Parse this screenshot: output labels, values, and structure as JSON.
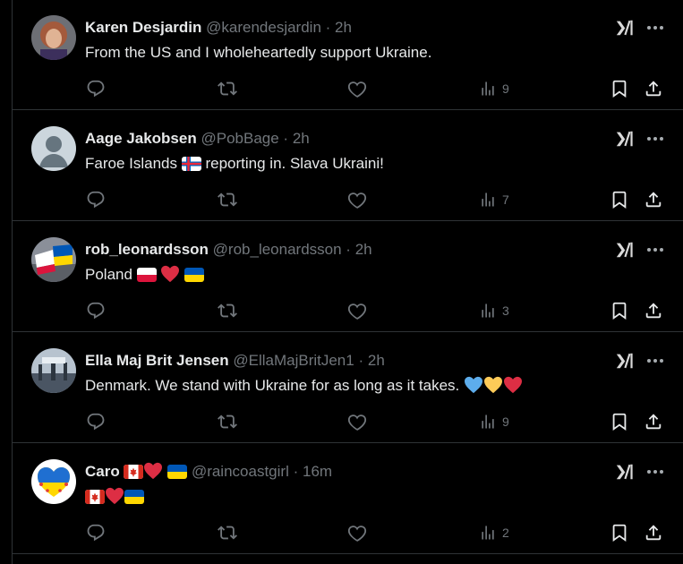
{
  "tweets": [
    {
      "name": "Karen Desjardin",
      "handle": "@karendesjardin",
      "dot": "·",
      "time": "2h",
      "text": "From the US and I wholeheartedly support Ukraine.",
      "views": "9",
      "avatar": "photo-avatar"
    },
    {
      "name": "Aage Jakobsen",
      "handle": "@PobBage",
      "dot": "·",
      "time": "2h",
      "text_before": "Faroe Islands",
      "text_after": "reporting in. Slava Ukraini!",
      "views": "7",
      "avatar": "default-avatar"
    },
    {
      "name": "rob_leonardsson",
      "handle": "@rob_leonardsson",
      "dot": "·",
      "time": "2h",
      "text": "Poland",
      "views": "3",
      "avatar": "flags-photo-avatar"
    },
    {
      "name": "Ella Maj Brit Jensen",
      "handle": "@EllaMajBritJen1",
      "dot": "·",
      "time": "2h",
      "text": "Denmark. We stand with Ukraine for as long as it takes.",
      "views": "9",
      "avatar": "crowd-photo-avatar"
    },
    {
      "name": "Caro",
      "handle": "@raincoastgirl",
      "dot": "·",
      "time": "16m",
      "views": "2",
      "avatar": "ukraine-heart-avatar"
    }
  ],
  "icons": {
    "reply": "reply-icon",
    "retweet": "retweet-icon",
    "like": "like-icon",
    "views": "views-icon",
    "bookmark": "bookmark-icon",
    "share": "share-icon",
    "grok": "grok-icon",
    "more": "more-icon"
  },
  "colors": {
    "background": "#000000",
    "border": "#2f3336",
    "text": "#e7e9ea",
    "secondary": "#71767b"
  }
}
